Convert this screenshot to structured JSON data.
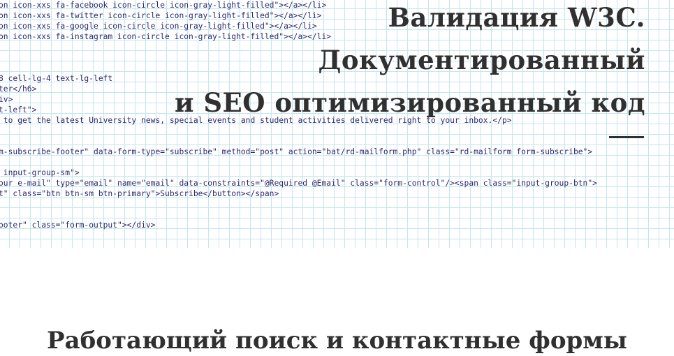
{
  "hero": {
    "code_lines": [
      "on icon-xxs fa-facebook icon-circle icon-gray-light-filled\"></a></li>",
      "on icon-xxs fa-twitter icon-circle icon-gray-light-filled\"></a></li>",
      "on icon-xxs fa-google icon-circle icon-gray-light-filled\"></a></li>",
      "on icon-xxs fa-instagram icon-circle icon-gray-light-filled\"></a></li>",
      "",
      "",
      "",
      "8 cell-lg-4 text-lg-left",
      "ter</h6>",
      "iv>",
      "t-left\">",
      " to get the latest University news, special events and student activities delivered right to your inbox.</p>",
      "",
      "",
      "m-subscribe-footer\" data-form-type=\"subscribe\" method=\"post\" action=\"bat/rd-mailform.php\" class=\"rd-mailform form-subscribe\">",
      "",
      " input-group-sm\">",
      "our e-mail\" type=\"email\" name=\"email\" data-constraints=\"@Required @Email\" class=\"form-control\"/><span class=\"input-group-btn\">",
      "t\" class=\"btn btn-sm btn-primary\">Subscribe</button></span>",
      "",
      "",
      "ooter\" class=\"form-output\"></div>"
    ],
    "headline_lines": [
      "Валидация W3C.",
      "Документированный",
      "и SEO оптимизированный код"
    ]
  },
  "next_section": {
    "title": "Работающий поиск и контактные формы"
  },
  "colors": {
    "grid": "#c6e4f2",
    "code_text": "#2a2a6e",
    "heading": "#303030",
    "background": "#ffffff"
  }
}
